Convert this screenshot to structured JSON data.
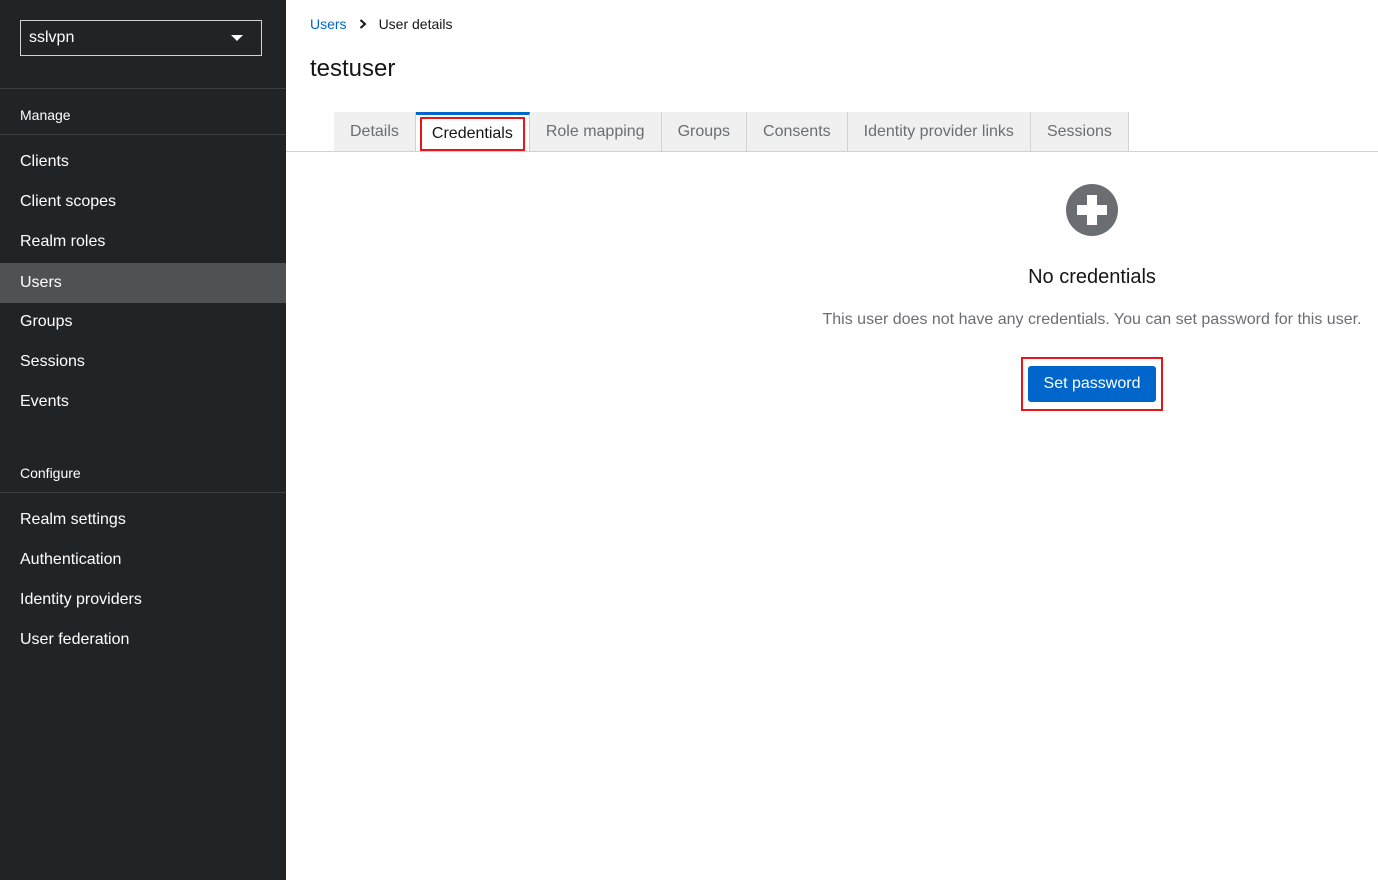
{
  "sidebar": {
    "realm": "sslvpn",
    "sections": [
      {
        "title": "Manage",
        "items": [
          {
            "label": "Clients"
          },
          {
            "label": "Client scopes"
          },
          {
            "label": "Realm roles"
          },
          {
            "label": "Users",
            "active": true
          },
          {
            "label": "Groups"
          },
          {
            "label": "Sessions"
          },
          {
            "label": "Events"
          }
        ]
      },
      {
        "title": "Configure",
        "items": [
          {
            "label": "Realm settings"
          },
          {
            "label": "Authentication"
          },
          {
            "label": "Identity providers"
          },
          {
            "label": "User federation"
          }
        ]
      }
    ]
  },
  "breadcrumb": {
    "parent": "Users",
    "current": "User details"
  },
  "page": {
    "title": "testuser"
  },
  "tabs": [
    {
      "label": "Details"
    },
    {
      "label": "Credentials",
      "active": true
    },
    {
      "label": "Role mapping"
    },
    {
      "label": "Groups"
    },
    {
      "label": "Consents"
    },
    {
      "label": "Identity provider links"
    },
    {
      "label": "Sessions"
    }
  ],
  "empty_state": {
    "icon": "plus-circle-icon",
    "title": "No credentials",
    "body": "This user does not have any credentials. You can set password for this user.",
    "action_label": "Set password"
  },
  "colors": {
    "sidebar_bg": "#212427",
    "active_nav_bg": "#4f5255",
    "primary": "#0066cc",
    "highlight": "#e8151b"
  }
}
